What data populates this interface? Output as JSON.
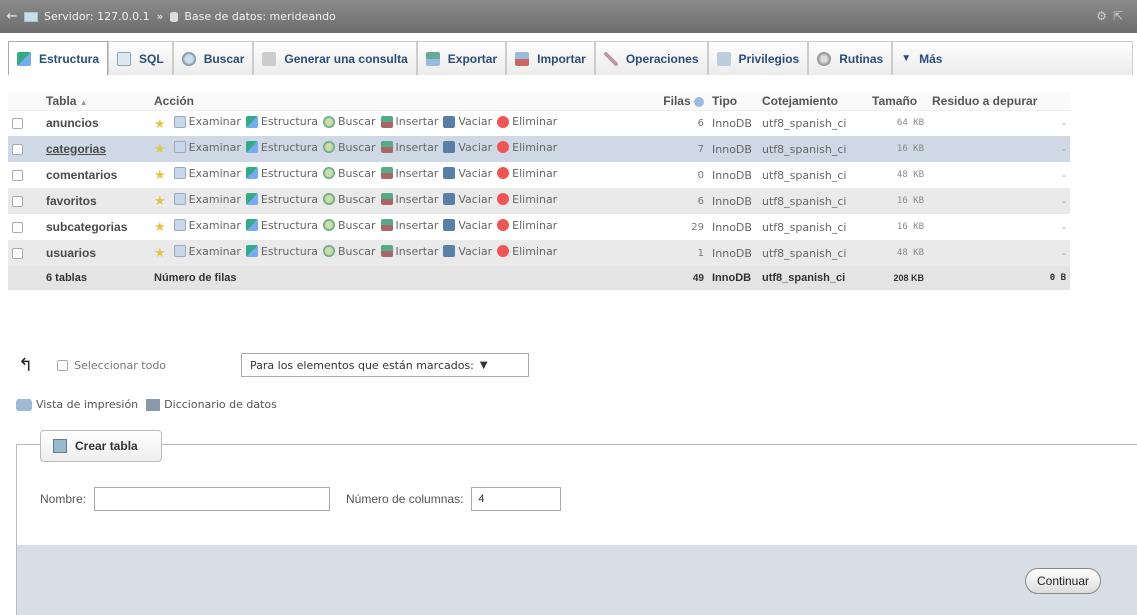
{
  "topbar": {
    "server_label": "Servidor: 127.0.0.1",
    "separator": "»",
    "db_label": "Base de datos: merideando"
  },
  "tabs": [
    {
      "label": "Estructura",
      "icon": "structure-icon",
      "active": true
    },
    {
      "label": "SQL",
      "icon": "sql-icon"
    },
    {
      "label": "Buscar",
      "icon": "search-icon"
    },
    {
      "label": "Generar una consulta",
      "icon": "query-icon"
    },
    {
      "label": "Exportar",
      "icon": "export-icon"
    },
    {
      "label": "Importar",
      "icon": "import-icon"
    },
    {
      "label": "Operaciones",
      "icon": "wrench-icon"
    },
    {
      "label": "Privilegios",
      "icon": "privileges-icon"
    },
    {
      "label": "Rutinas",
      "icon": "routines-icon"
    },
    {
      "label": "Más",
      "icon": "triangle-down-icon"
    }
  ],
  "table": {
    "headers": {
      "tabla": "Tabla",
      "sort_arrow": "▲",
      "accion": "Acción",
      "filas": "Filas",
      "tipo": "Tipo",
      "cotejamiento": "Cotejamiento",
      "tamano": "Tamaño",
      "residuo": "Residuo a depurar"
    },
    "actions": {
      "examinar": "Examinar",
      "estructura": "Estructura",
      "buscar": "Buscar",
      "insertar": "Insertar",
      "vaciar": "Vaciar",
      "eliminar": "Eliminar"
    },
    "rows": [
      {
        "name": "anuncios",
        "rows": "6",
        "type": "InnoDB",
        "collation": "utf8_spanish_ci",
        "size": "64 KB",
        "overhead": "-"
      },
      {
        "name": "categorias",
        "rows": "7",
        "type": "InnoDB",
        "collation": "utf8_spanish_ci",
        "size": "16 KB",
        "overhead": "-"
      },
      {
        "name": "comentarios",
        "rows": "0",
        "type": "InnoDB",
        "collation": "utf8_spanish_ci",
        "size": "48 KB",
        "overhead": "-"
      },
      {
        "name": "favoritos",
        "rows": "6",
        "type": "InnoDB",
        "collation": "utf8_spanish_ci",
        "size": "16 KB",
        "overhead": "-"
      },
      {
        "name": "subcategorias",
        "rows": "29",
        "type": "InnoDB",
        "collation": "utf8_spanish_ci",
        "size": "16 KB",
        "overhead": "-"
      },
      {
        "name": "usuarios",
        "rows": "1",
        "type": "InnoDB",
        "collation": "utf8_spanish_ci",
        "size": "48 KB",
        "overhead": "-"
      }
    ],
    "footer": {
      "count": "6 tablas",
      "label": "Número de filas",
      "rows": "49",
      "type": "InnoDB",
      "collation": "utf8_spanish_ci",
      "size": "208 KB",
      "overhead": "0 B"
    }
  },
  "bulk": {
    "select_all": "Seleccionar todo",
    "dropdown_value": "Para los elementos que están marcados:",
    "caret": "▼"
  },
  "links": {
    "print_view": "Vista de impresión",
    "data_dictionary": "Diccionario de datos"
  },
  "create_table": {
    "legend": "Crear tabla",
    "name_label": "Nombre:",
    "name_value": "",
    "columns_label": "Número de columnas:",
    "columns_value": "4",
    "submit": "Continuar"
  }
}
